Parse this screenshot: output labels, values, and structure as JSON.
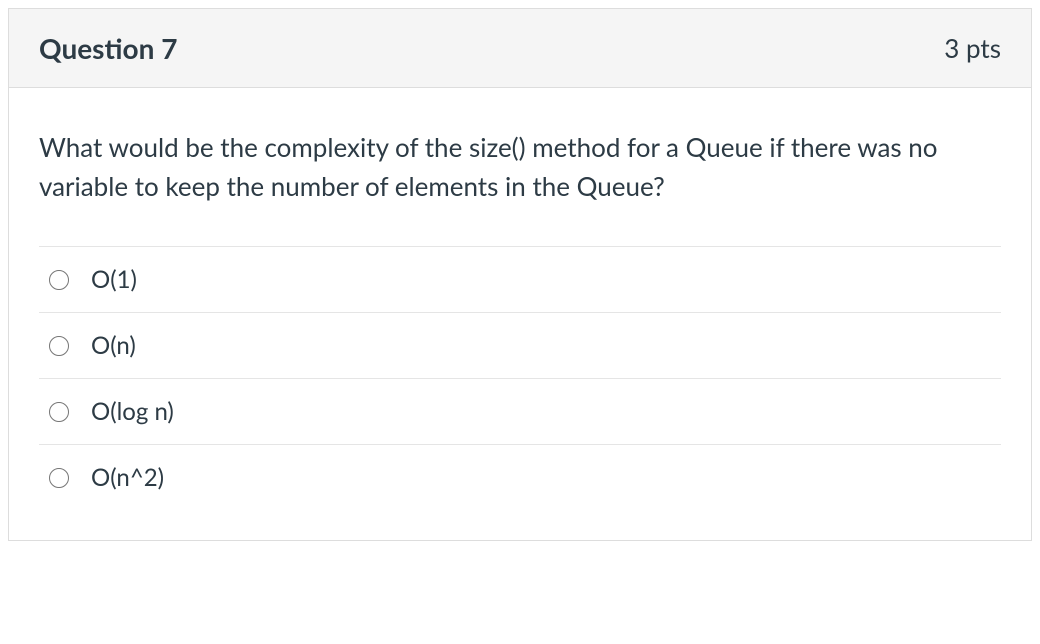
{
  "header": {
    "title": "Question 7",
    "points": "3 pts"
  },
  "prompt": "What would be the complexity of the size() method for a Queue if there was no variable to keep the number of elements in the Queue?",
  "options": [
    {
      "label": "O(1)"
    },
    {
      "label": "O(n)"
    },
    {
      "label": "O(log n)"
    },
    {
      "label": "O(n^2)"
    }
  ]
}
